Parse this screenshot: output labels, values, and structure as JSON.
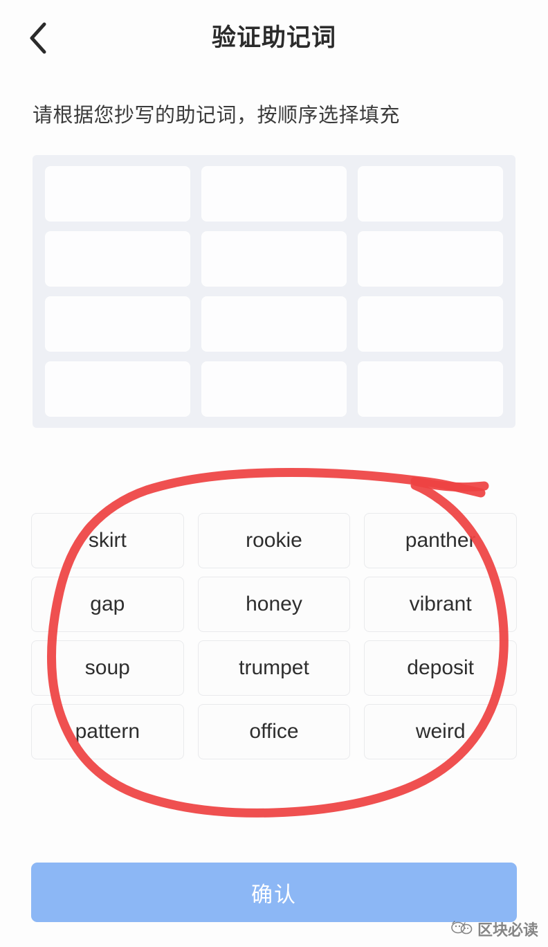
{
  "header": {
    "title": "验证助记词",
    "back_icon": "chevron-left-icon"
  },
  "subtitle": "请根据您抄写的助记词，按顺序选择填充",
  "slot_panel": {
    "rows": 4,
    "columns": 3,
    "total_slots": 12,
    "slots": [
      "",
      "",
      "",
      "",
      "",
      "",
      "",
      "",
      "",
      "",
      "",
      ""
    ],
    "panel_color": "#eef0f5",
    "slot_color": "#fdfdfe"
  },
  "word_bank": {
    "rows": 4,
    "columns": 3,
    "words": [
      "skirt",
      "rookie",
      "panther",
      "gap",
      "honey",
      "vibrant",
      "soup",
      "trumpet",
      "deposit",
      "pattern",
      "office",
      "weird"
    ],
    "chip_bg": "#fcfcfc",
    "chip_border": "#e9eaec",
    "text_color": "#2e2e2e"
  },
  "annotation": {
    "type": "hand-drawn-circle",
    "color": "#ee4343",
    "stroke_width": 13,
    "note": "red circle highlighting the word bank"
  },
  "confirm_button": {
    "label": "确认",
    "bg_color": "#8cb7f5",
    "text_color": "#ffffff"
  },
  "watermark": {
    "text": "区块必读",
    "logo_icon": "wechat-cat-logo-icon"
  }
}
